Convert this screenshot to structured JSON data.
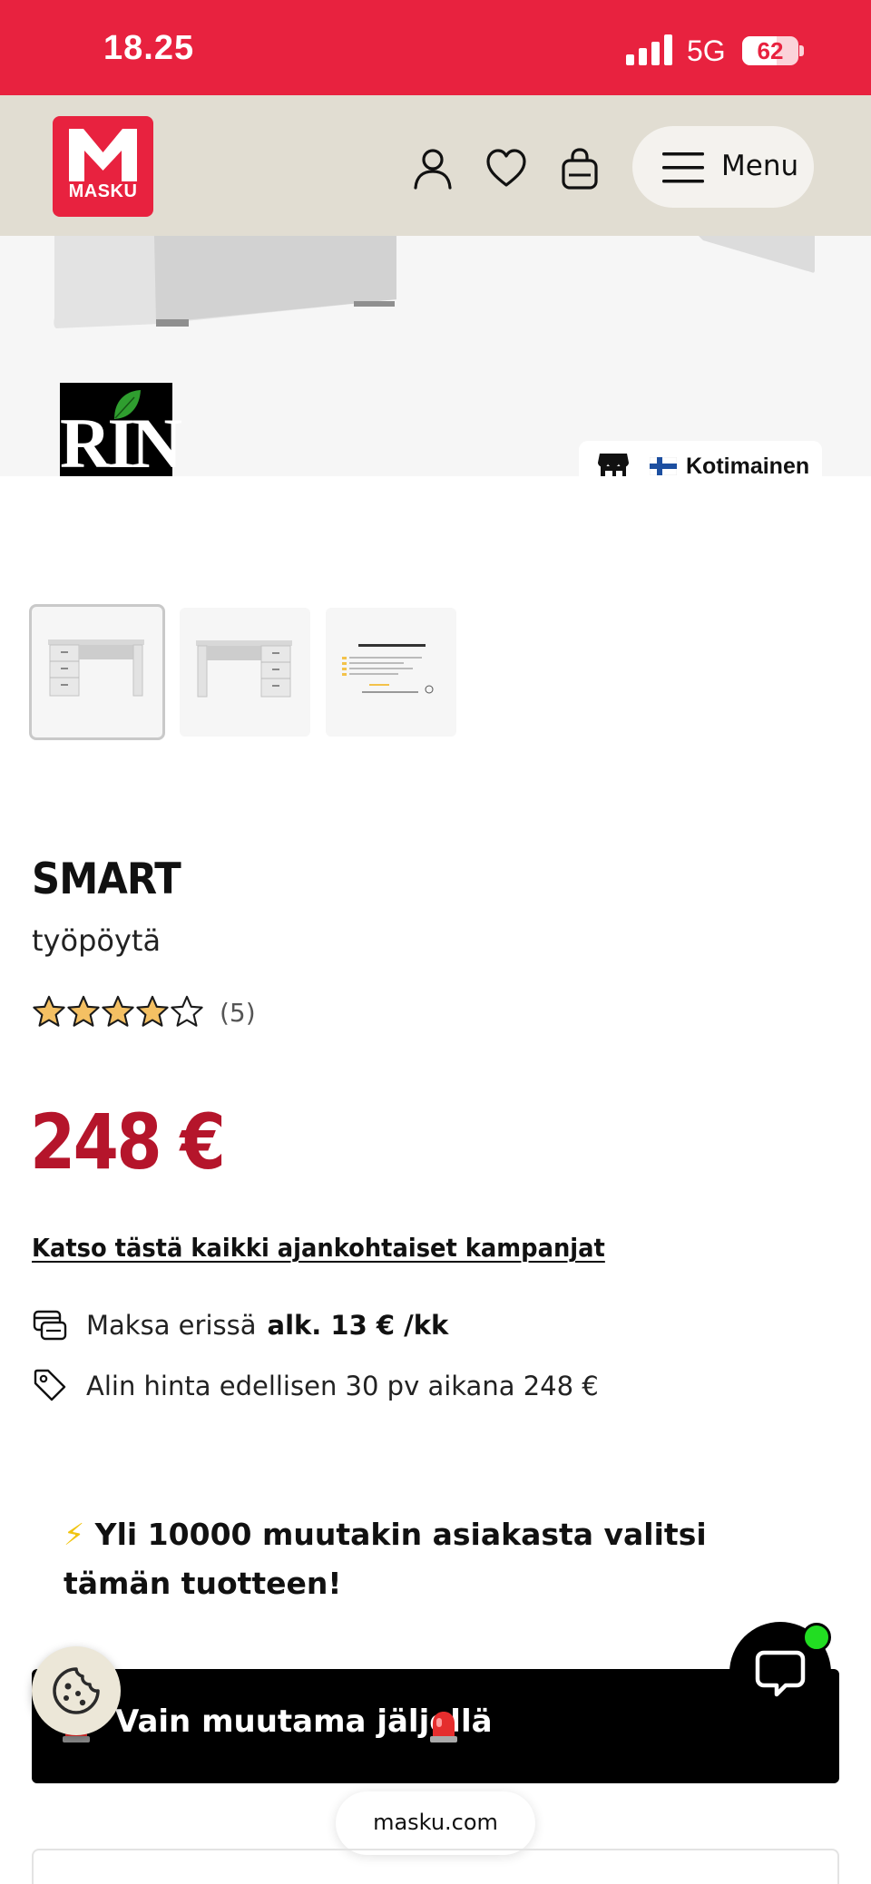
{
  "status_bar": {
    "time": "18.25",
    "network": "5G",
    "battery_percent": "62",
    "battery_level": 0.62
  },
  "header": {
    "logo_text": "MASKU",
    "menu_label": "Menu",
    "icons": [
      "user-icon",
      "heart-icon",
      "bag-icon",
      "hamburger-icon"
    ]
  },
  "hero": {
    "brand_logo_text": "RIN",
    "origin_badge": "Kotimainen",
    "origin_flag": "finland-flag"
  },
  "gallery": {
    "thumbnails": [
      "desk-front",
      "desk-alt",
      "info-card"
    ],
    "active_index": 0
  },
  "product": {
    "name": "SMART",
    "type": "työpöytä",
    "rating": 4,
    "rating_max": 5,
    "review_count": "(5)",
    "price": "248 €",
    "campaign_link": "Katso tästä kaikki ajankohtaiset kampanjat",
    "installment_label": "Maksa erissä",
    "installment_value": "alk. 13 € /kk",
    "lowest_price_note": "Alin hinta edellisen 30 pv aikana 248 €"
  },
  "social_proof": {
    "emoji": "⚡",
    "text": "Yli 10000 muutakin asiakasta valitsi tämän tuotteen!"
  },
  "scarcity_banner": {
    "text": "Vain muutama jäljellä",
    "emoji": "🚨"
  },
  "browser": {
    "url": "masku.com"
  },
  "colors": {
    "brand_red": "#e8223f",
    "price_red": "#b5152b",
    "header_bg": "#e1ddd2",
    "banner_bg": "#000000",
    "online_dot": "#22dd22"
  }
}
